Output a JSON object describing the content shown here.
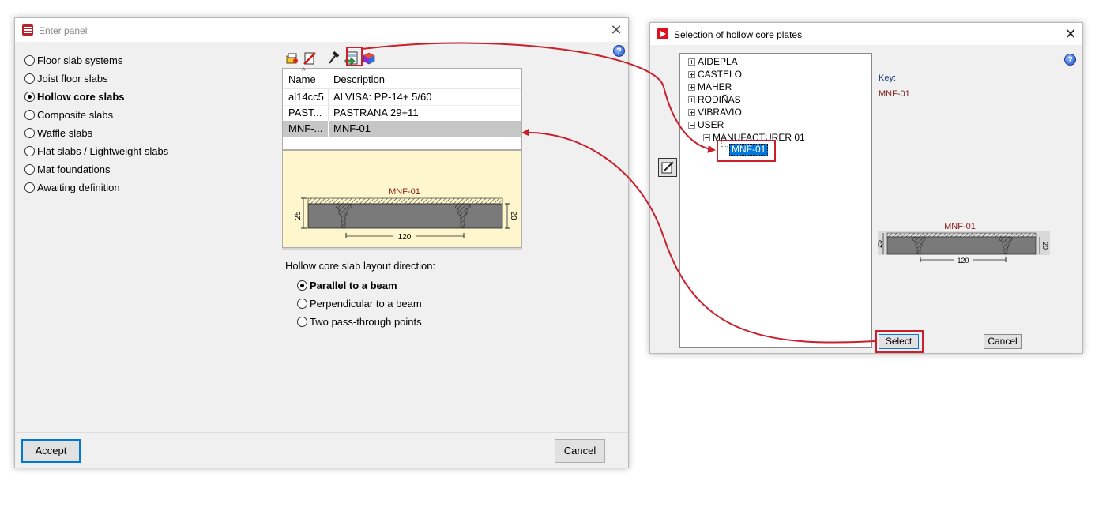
{
  "enter_panel": {
    "title": "Enter panel",
    "slab_types": [
      {
        "label": "Floor slab systems",
        "selected": false
      },
      {
        "label": "Joist floor slabs",
        "selected": false
      },
      {
        "label": "Hollow core slabs",
        "selected": true
      },
      {
        "label": "Composite slabs",
        "selected": false
      },
      {
        "label": "Waffle slabs",
        "selected": false
      },
      {
        "label": "Flat slabs / Lightweight slabs",
        "selected": false
      },
      {
        "label": "Mat foundations",
        "selected": false
      },
      {
        "label": "Awaiting definition",
        "selected": false
      }
    ],
    "table": {
      "headers": [
        "Name",
        "Description"
      ],
      "rows": [
        {
          "name": "al14cc5",
          "description": "ALVISA: PP-14+ 5/60",
          "selected": false
        },
        {
          "name": "PAST...",
          "description": "PASTRANA 29+11",
          "selected": false
        },
        {
          "name": "MNF-...",
          "description": "MNF-01",
          "selected": true
        }
      ]
    },
    "preview": {
      "title": "MNF-01",
      "dim_left": "25",
      "dim_right": "20",
      "dim_bottom": "120"
    },
    "layout_direction": {
      "label": "Hollow core slab layout direction:",
      "options": [
        {
          "label": "Parallel to a beam",
          "selected": true
        },
        {
          "label": "Perpendicular to a beam",
          "selected": false
        },
        {
          "label": "Two pass-through points",
          "selected": false
        }
      ]
    },
    "accept_label": "Accept",
    "cancel_label": "Cancel",
    "help_glyph": "?"
  },
  "hollow_core_selection": {
    "title": "Selection of hollow core plates",
    "tree": {
      "manufacturers": [
        "AIDEPLA",
        "CASTELO",
        "MAHER",
        "RODIÑAS",
        "VIBRAVIO"
      ],
      "user_label": "USER",
      "manufacturer_label": "MANUFACTURER 01",
      "leaf_label": "MNF-01"
    },
    "key_label": "Key:",
    "key_value": "MNF-01",
    "preview": {
      "title": "MNF-01",
      "dim_left": "25",
      "dim_right": "20",
      "dim_bottom": "120"
    },
    "select_label": "Select",
    "cancel_label": "Cancel",
    "help_glyph": "?"
  },
  "colors": {
    "highlight": "#c8202c",
    "selection": "#0078d7",
    "preview_bg": "#fef7cd",
    "section_fill": "#7a7a7a"
  }
}
